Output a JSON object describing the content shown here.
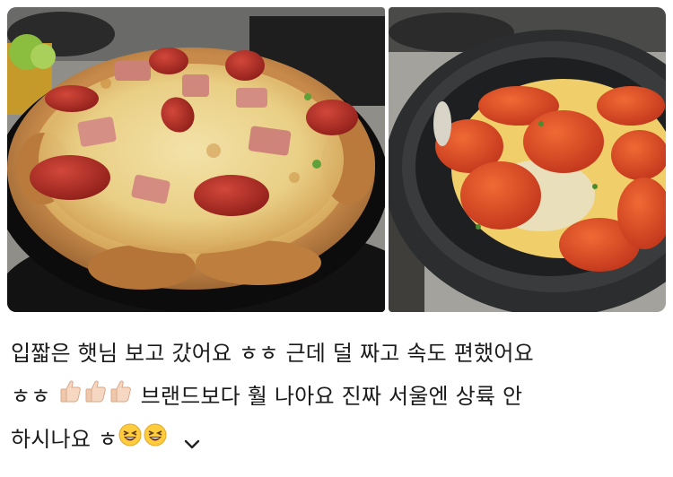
{
  "post": {
    "line1": "입짧은 햇님 보고 갔어요 ㅎㅎ 근데 덜 짜고 속도 편했어요",
    "line2_prefix": "ㅎㅎ",
    "line2_text": "브랜드보다 훨 나아요 진짜 서울엔 상륙 안",
    "line3_text": "하시나요 ㅎ"
  },
  "icons": {
    "thumb": "thumbs-up-emoji",
    "grin": "grinning-squinting-emoji",
    "expand": "chevron-down-icon"
  }
}
